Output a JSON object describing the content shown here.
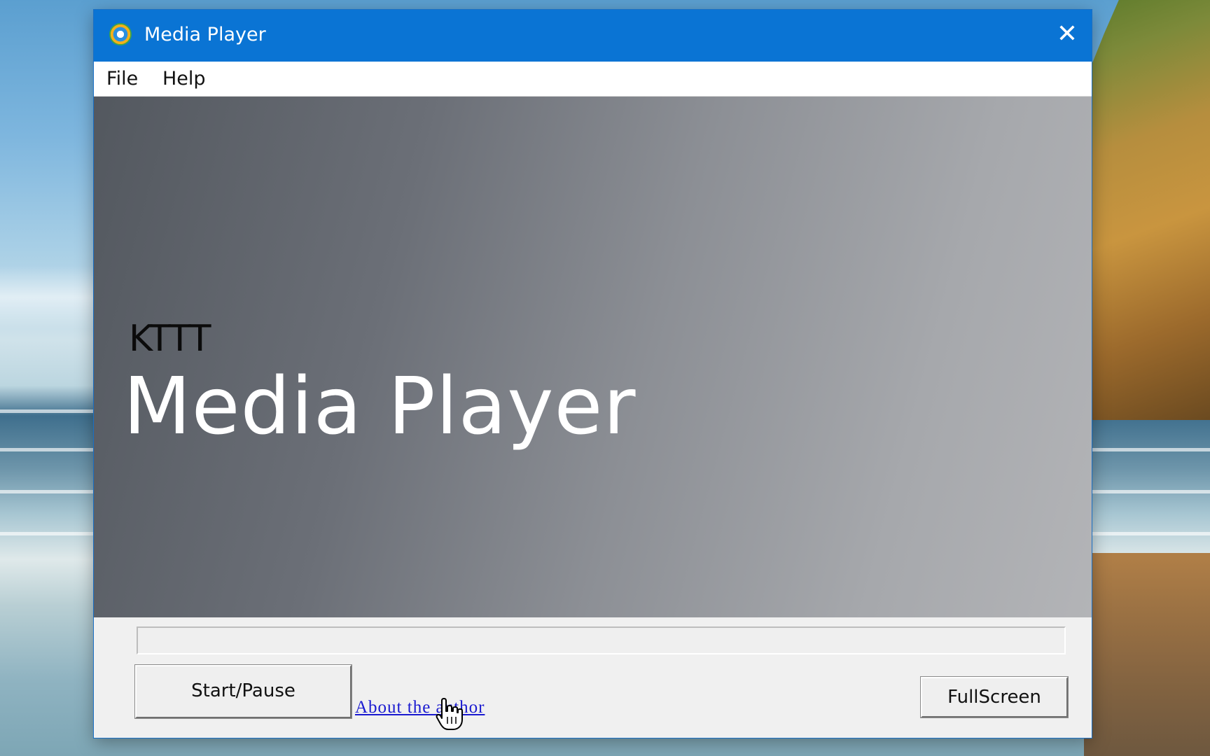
{
  "window": {
    "title": "Media Player",
    "app_icon": "media-player-app-icon",
    "close_glyph": "✕"
  },
  "menu": {
    "items": [
      {
        "label": "File"
      },
      {
        "label": "Help"
      }
    ]
  },
  "splash": {
    "brand": "KTTT",
    "title": "Media Player"
  },
  "progress": {
    "value_percent": 0
  },
  "controls": {
    "start_pause_label": "Start/Pause",
    "about_link_label": "About the author",
    "fullscreen_label": "FullScreen"
  },
  "colors": {
    "titlebar": "#0a74d4",
    "link": "#1a1ad0"
  },
  "icons": {
    "cursor": "hand-pointer-icon"
  }
}
